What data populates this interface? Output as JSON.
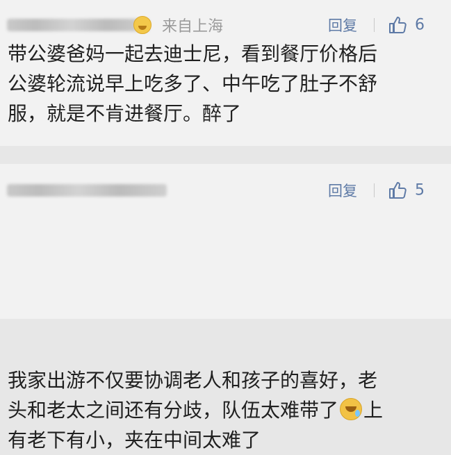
{
  "comments": [
    {
      "location": "来自上海",
      "reply_label": "回复",
      "likes": "6",
      "lines": [
        "带公婆爸妈一起去迪士尼，看到餐厅价格后",
        "公婆轮流说早上吃多了、中午吃了肚子不舒",
        "服，就是不肯进餐厅。醉了"
      ]
    },
    {
      "reply_label": "回复",
      "likes": "5",
      "lines": [
        "我家出游不仅要协调老人和孩子的喜好，老",
        "头和老太之间还有分歧，队伍太难带了",
        "上",
        "有老下有小，夹在中间太难了"
      ]
    }
  ],
  "icons": {
    "user_emoji": "smiling-face-emoji-icon",
    "like": "thumbs-up-icon",
    "inline_emoji": "laughing-tears-emoji-icon"
  },
  "colors": {
    "text": "#202020",
    "meta": "#9b9b9b",
    "link": "#5e7aa6",
    "card": "#f2f2f2",
    "divider": "#e7e7e7"
  }
}
